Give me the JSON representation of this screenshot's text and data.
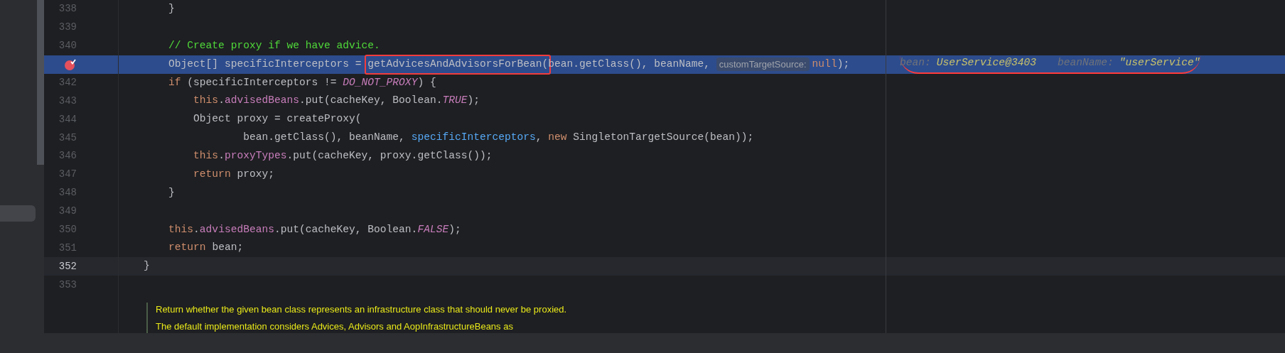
{
  "sidebar": {
    "items": [
      {
        "selected": true
      }
    ]
  },
  "editor": {
    "lines": [
      {
        "number": "338",
        "execution": false,
        "breakpoint": false,
        "caret": false,
        "tokens": [
          {
            "kind": "plain",
            "text": "        }"
          }
        ]
      },
      {
        "number": "339",
        "execution": false,
        "breakpoint": false,
        "caret": false
      },
      {
        "number": "340",
        "execution": false,
        "breakpoint": false,
        "caret": false,
        "tokens": [
          {
            "kind": "comment",
            "text": "        // Create proxy if we have advice."
          }
        ]
      },
      {
        "execution": true,
        "breakpoint": true,
        "caret": false,
        "tokens": [
          {
            "kind": "plain",
            "text": "        Object[] specificInterceptors = "
          },
          {
            "kind": "plain",
            "text": "getAdvicesAndAdvisorsForBean(",
            "boxed": true
          },
          {
            "kind": "plain",
            "text": "bean.getClass(), beanName, "
          },
          {
            "kind": "hint",
            "text": "customTargetSource:"
          },
          {
            "kind": "keyword",
            "text": "null"
          },
          {
            "kind": "plain",
            "text": ");"
          }
        ],
        "debug_values": {
          "underlined": true,
          "items": [
            {
              "name": "bean:",
              "value": "UserService@3403"
            },
            {
              "name": "beanName:",
              "value": "\"userService\""
            }
          ]
        }
      },
      {
        "number": "342",
        "execution": false,
        "breakpoint": false,
        "caret": false,
        "tokens": [
          {
            "kind": "keyword",
            "text": "        if"
          },
          {
            "kind": "plain",
            "text": " (specificInterceptors != "
          },
          {
            "kind": "constant",
            "text": "DO_NOT_PROXY"
          },
          {
            "kind": "plain",
            "text": ") {"
          }
        ]
      },
      {
        "number": "343",
        "execution": false,
        "breakpoint": false,
        "caret": false,
        "tokens": [
          {
            "kind": "keyword",
            "text": "            this"
          },
          {
            "kind": "plain",
            "text": "."
          },
          {
            "kind": "field",
            "text": "advisedBeans"
          },
          {
            "kind": "plain",
            "text": ".put(cacheKey, Boolean."
          },
          {
            "kind": "constant",
            "text": "TRUE"
          },
          {
            "kind": "plain",
            "text": ");"
          }
        ]
      },
      {
        "number": "344",
        "execution": false,
        "breakpoint": false,
        "caret": false,
        "tokens": [
          {
            "kind": "plain",
            "text": "            Object proxy = createProxy("
          }
        ]
      },
      {
        "number": "345",
        "execution": false,
        "breakpoint": false,
        "caret": false,
        "tokens": [
          {
            "kind": "plain",
            "text": "                    bean.getClass(), beanName, "
          },
          {
            "kind": "variable",
            "text": "specificInterceptors"
          },
          {
            "kind": "plain",
            "text": ", "
          },
          {
            "kind": "keyword",
            "text": "new"
          },
          {
            "kind": "plain",
            "text": " SingletonTargetSource(bean));"
          }
        ]
      },
      {
        "number": "346",
        "execution": false,
        "breakpoint": false,
        "caret": false,
        "tokens": [
          {
            "kind": "keyword",
            "text": "            this"
          },
          {
            "kind": "plain",
            "text": "."
          },
          {
            "kind": "field",
            "text": "proxyTypes"
          },
          {
            "kind": "plain",
            "text": ".put(cacheKey, proxy.getClass());"
          }
        ]
      },
      {
        "number": "347",
        "execution": false,
        "breakpoint": false,
        "caret": false,
        "tokens": [
          {
            "kind": "keyword",
            "text": "            return"
          },
          {
            "kind": "plain",
            "text": " proxy;"
          }
        ]
      },
      {
        "number": "348",
        "execution": false,
        "breakpoint": false,
        "caret": false,
        "tokens": [
          {
            "kind": "plain",
            "text": "        }"
          }
        ]
      },
      {
        "number": "349",
        "execution": false,
        "breakpoint": false,
        "caret": false
      },
      {
        "number": "350",
        "execution": false,
        "breakpoint": false,
        "caret": false,
        "tokens": [
          {
            "kind": "keyword",
            "text": "        this"
          },
          {
            "kind": "plain",
            "text": "."
          },
          {
            "kind": "field",
            "text": "advisedBeans"
          },
          {
            "kind": "plain",
            "text": ".put(cacheKey, Boolean."
          },
          {
            "kind": "constant",
            "text": "FALSE"
          },
          {
            "kind": "plain",
            "text": ");"
          }
        ]
      },
      {
        "number": "351",
        "execution": false,
        "breakpoint": false,
        "caret": false,
        "tokens": [
          {
            "kind": "keyword",
            "text": "        return"
          },
          {
            "kind": "plain",
            "text": " bean;"
          }
        ]
      },
      {
        "number": "352",
        "execution": false,
        "breakpoint": false,
        "caret": true,
        "tokens": [
          {
            "kind": "plain",
            "text": "    }"
          }
        ]
      },
      {
        "number": "353",
        "execution": false,
        "breakpoint": false,
        "caret": false
      }
    ],
    "doc": [
      "Return whether the given bean class represents an infrastructure class that should never be proxied.",
      "The default implementation considers Advices, Advisors and AopInfrastructureBeans as"
    ]
  }
}
